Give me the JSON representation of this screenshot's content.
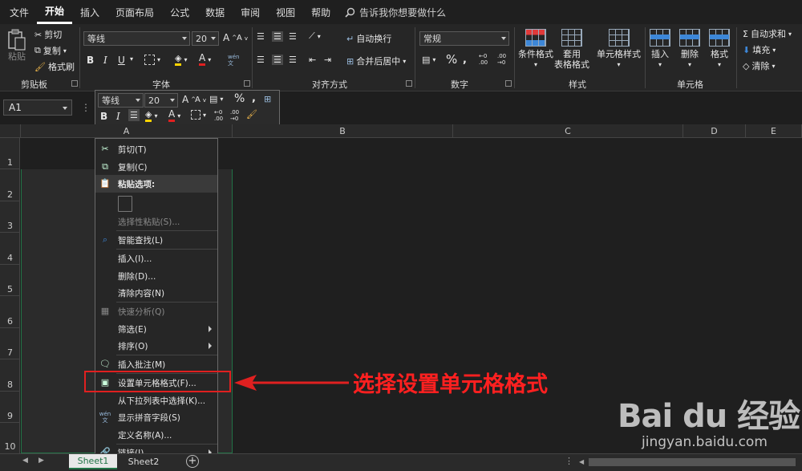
{
  "menu": {
    "tabs": [
      "文件",
      "开始",
      "插入",
      "页面布局",
      "公式",
      "数据",
      "审阅",
      "视图",
      "帮助"
    ],
    "active": "开始",
    "tell_me": "告诉我你想要做什么"
  },
  "ribbon": {
    "clipboard": {
      "paste": "粘贴",
      "cut": "剪切",
      "copy": "复制",
      "format_painter": "格式刷",
      "label": "剪贴板"
    },
    "font": {
      "family": "等线",
      "size": "20",
      "bold": "B",
      "italic": "I",
      "underline": "U",
      "font_color": "A",
      "label": "字体"
    },
    "alignment": {
      "wrap": "自动换行",
      "merge": "合并后居中",
      "label": "对齐方式"
    },
    "number": {
      "format": "常规",
      "percent": "%",
      "label": "数字"
    },
    "styles": {
      "conditional": "条件格式",
      "table_format_1": "套用",
      "table_format_2": "表格格式",
      "cell_styles": "单元格样式",
      "label": "样式"
    },
    "cells": {
      "insert": "插入",
      "delete": "删除",
      "format": "格式",
      "label": "单元格"
    },
    "editing": {
      "autosum": "自动求和",
      "fill": "填充",
      "clear": "清除"
    }
  },
  "name_box": "A1",
  "mini_toolbar": {
    "font": "等线",
    "size": "20",
    "bold": "B",
    "italic": "I",
    "font_color": "A",
    "percent": "%"
  },
  "columns": [
    "A",
    "B",
    "C",
    "D",
    "E"
  ],
  "rows": [
    "1",
    "2",
    "3",
    "4",
    "5",
    "6",
    "7",
    "8",
    "9",
    "10"
  ],
  "context_menu": {
    "cut": "剪切(T)",
    "copy": "复制(C)",
    "paste_options": "粘贴选项:",
    "paste_special": "选择性粘贴(S)...",
    "smart_lookup": "智能查找(L)",
    "insert": "插入(I)...",
    "delete": "删除(D)...",
    "clear_contents": "清除内容(N)",
    "quick_analysis": "快速分析(Q)",
    "filter": "筛选(E)",
    "sort": "排序(O)",
    "insert_comment": "插入批注(M)",
    "format_cells": "设置单元格格式(F)...",
    "pick_from_list": "从下拉列表中选择(K)...",
    "phonetic": "显示拼音字段(S)",
    "define_name": "定义名称(A)...",
    "link": "链接(I)"
  },
  "callout": "选择设置单元格格式",
  "sheets": [
    "Sheet1",
    "Sheet2"
  ],
  "watermark": {
    "brand": "Bai du 经验",
    "url": "jingyan.baidu.com"
  },
  "colors": {
    "accent_red": "#e02020",
    "selection_green": "#217346",
    "highlight_blue": "#3d87d8"
  }
}
